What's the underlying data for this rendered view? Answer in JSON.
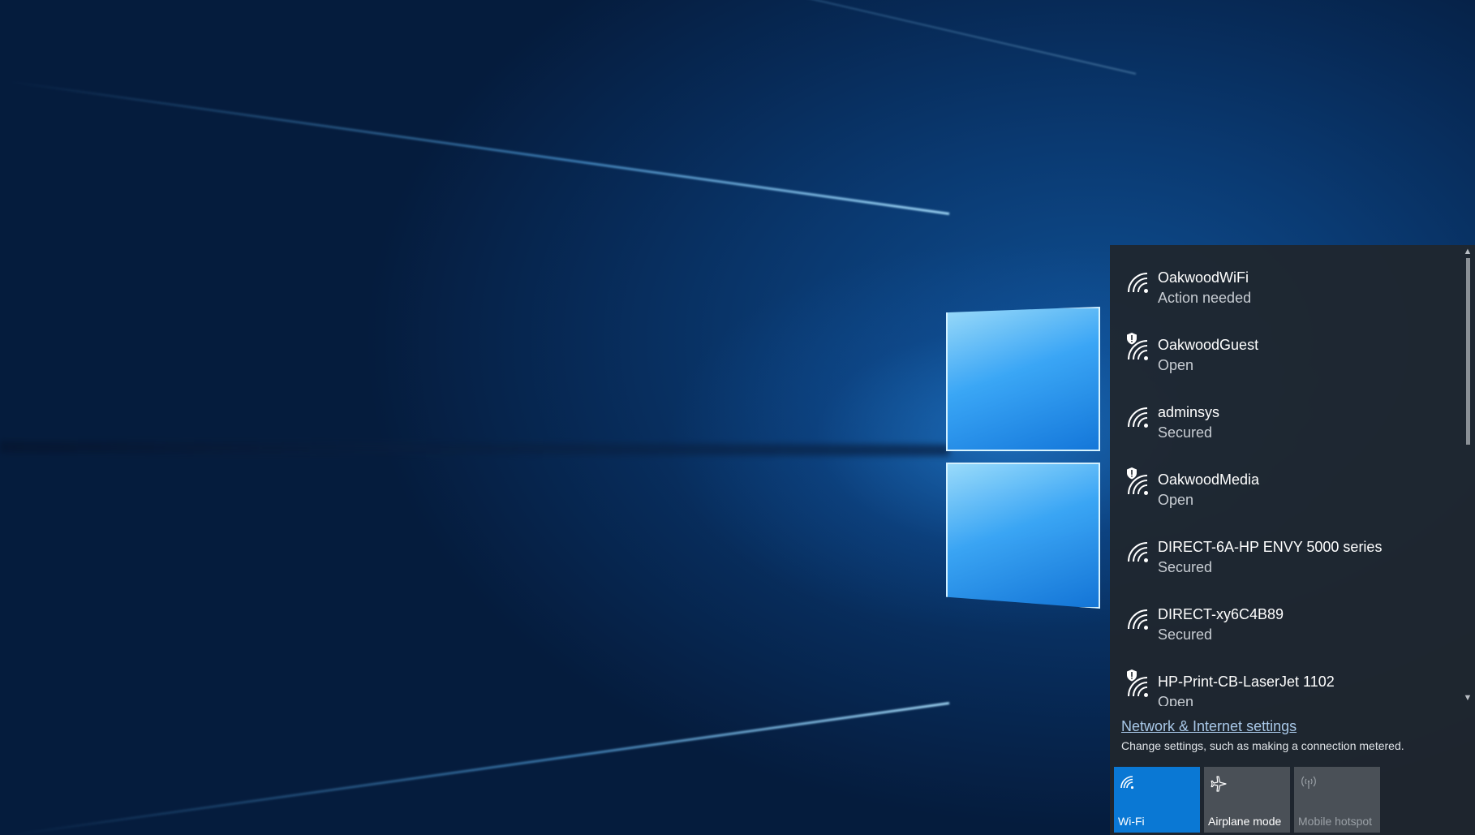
{
  "desktop": {
    "wallpaper": "windows-10-hero",
    "accent_color": "#0a78d4"
  },
  "network_flyout": {
    "networks": [
      {
        "name": "OakwoodWiFi",
        "status": "Action needed",
        "icon": "wifi-signal-icon",
        "open_warning": false
      },
      {
        "name": "OakwoodGuest",
        "status": "Open",
        "icon": "wifi-signal-icon",
        "open_warning": true
      },
      {
        "name": "adminsys",
        "status": "Secured",
        "icon": "wifi-signal-icon",
        "open_warning": false
      },
      {
        "name": "OakwoodMedia",
        "status": "Open",
        "icon": "wifi-signal-icon",
        "open_warning": true
      },
      {
        "name": "DIRECT-6A-HP ENVY 5000 series",
        "status": "Secured",
        "icon": "wifi-signal-icon",
        "open_warning": false
      },
      {
        "name": "DIRECT-xy6C4B89",
        "status": "Secured",
        "icon": "wifi-signal-icon",
        "open_warning": false
      },
      {
        "name": "HP-Print-CB-LaserJet 1102",
        "status": "Open",
        "icon": "wifi-signal-icon",
        "open_warning": true
      }
    ],
    "settings_link": "Network & Internet settings",
    "settings_description": "Change settings, such as making a connection metered.",
    "quick_actions": {
      "wifi": {
        "label": "Wi-Fi",
        "icon": "wifi-icon",
        "active": true
      },
      "airplane": {
        "label": "Airplane mode",
        "icon": "airplane-icon",
        "active": false
      },
      "hotspot": {
        "label": "Mobile hotspot",
        "icon": "hotspot-icon",
        "active": false,
        "disabled": true
      }
    }
  }
}
